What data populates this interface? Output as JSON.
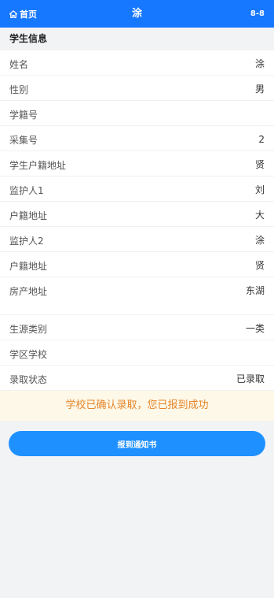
{
  "header": {
    "home_label": "首页",
    "title": "涂",
    "right_code": "8-8"
  },
  "section_title": "学生信息",
  "fields": [
    {
      "label": "姓名",
      "value": "涂"
    },
    {
      "label": "性别",
      "value": "男"
    },
    {
      "label": "学籍号",
      "value": ""
    },
    {
      "label": "采集号",
      "value": "2"
    },
    {
      "label": "学生户籍地址",
      "value": "贤"
    },
    {
      "label": "监护人1",
      "value": "刘"
    },
    {
      "label": "户籍地址",
      "value": "大"
    },
    {
      "label": "监护人2",
      "value": "涂"
    },
    {
      "label": "户籍地址",
      "value": "贤"
    },
    {
      "label": "房产地址",
      "value": "东湖"
    },
    {
      "label": "生源类别",
      "value": "一类"
    },
    {
      "label": "学区学校",
      "value": ""
    },
    {
      "label": "录取状态",
      "value": "已录取"
    }
  ],
  "notice": "学校已确认录取，您已报到成功",
  "report_button": "报到通知书",
  "colors": {
    "header_bg": "#1677ff",
    "notice_text": "#e6862b",
    "button_bg": "#1e90ff",
    "school_green": "#19be6b"
  }
}
